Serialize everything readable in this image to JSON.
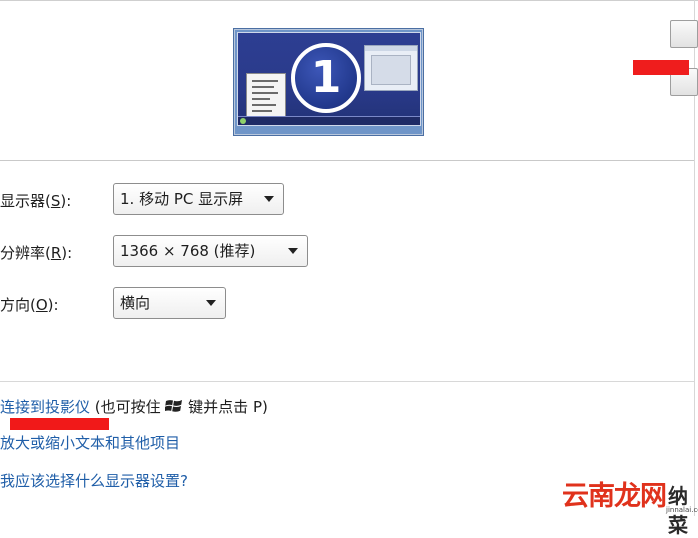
{
  "preview": {
    "monitor_number": "1"
  },
  "form": {
    "display": {
      "label_prefix": "显示器(",
      "label_key": "S",
      "label_suffix": "):",
      "value": "1. 移动 PC 显示屏"
    },
    "resolution": {
      "label_prefix": "分辨率(",
      "label_key": "R",
      "label_suffix": "):",
      "value": "1366 × 768 (推荐)"
    },
    "orientation": {
      "label_prefix": "方向(",
      "label_key": "O",
      "label_suffix": "):",
      "value": "横向"
    }
  },
  "links": {
    "projector": "连接到投影仪",
    "projector_hint_before": " (也可按住 ",
    "projector_hint_after": " 键并点击 P)",
    "text_size": "放大或缩小文本和其他项目",
    "which_settings": "我应该选择什么显示器设置?"
  },
  "watermark": {
    "main": "云南龙网",
    "tail": "纳菜",
    "url": "jinnalai.com"
  },
  "colors": {
    "link": "#1f5ea8",
    "highlight_red": "#ef1d1d",
    "badge_blue": "#233a8f"
  },
  "icons": {
    "windows_key": "windows-logo-icon",
    "dropdown": "chevron-down-icon"
  }
}
